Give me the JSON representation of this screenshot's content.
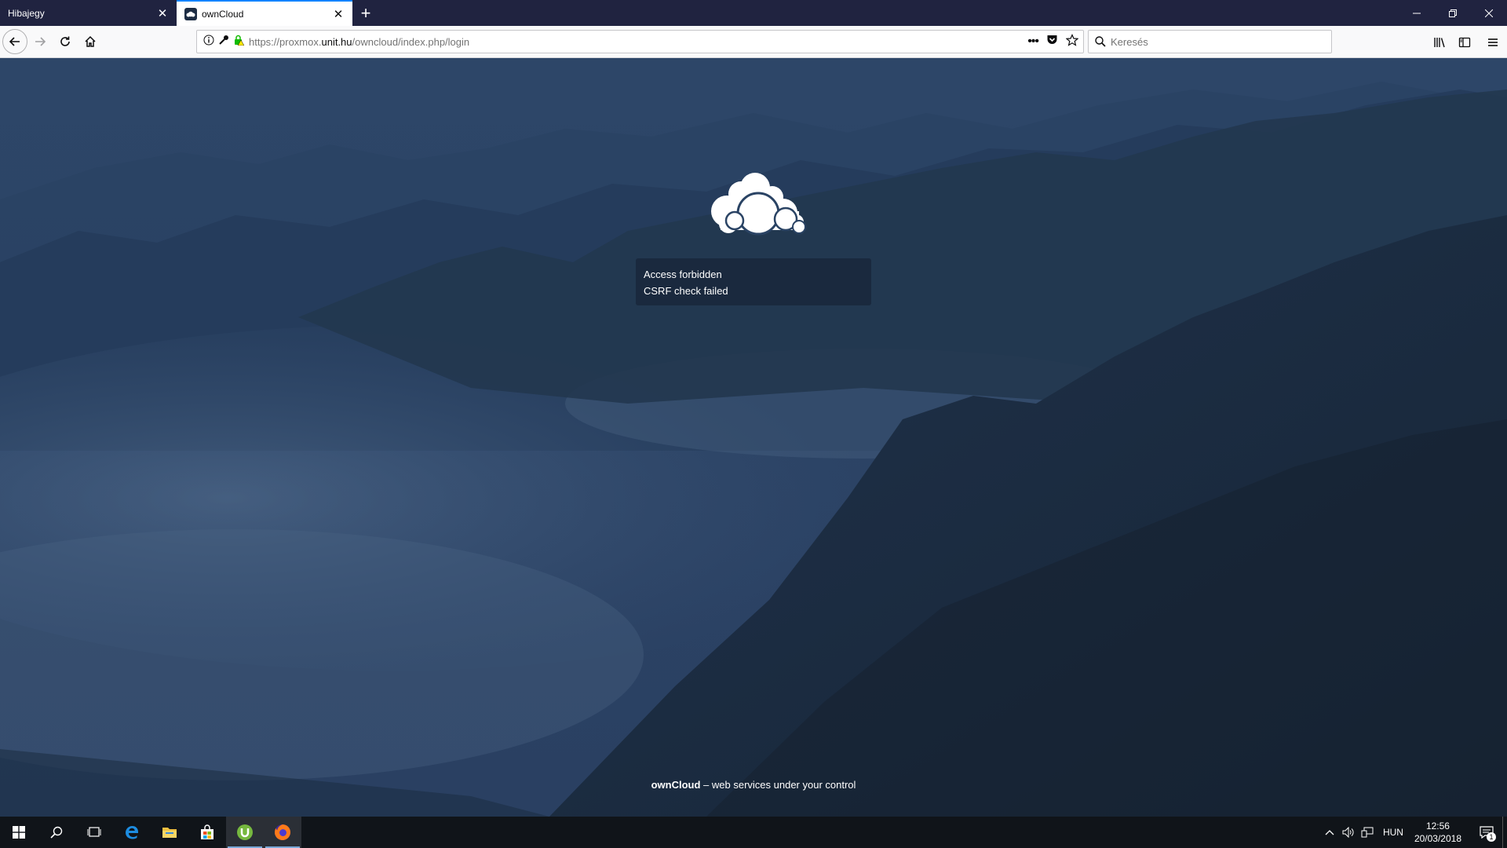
{
  "browser": {
    "tabs": [
      {
        "title": "Hibajegy",
        "active": false
      },
      {
        "title": "ownCloud",
        "active": true
      }
    ],
    "url": {
      "prefix": "https://proxmox.",
      "host": "unit.hu",
      "path": "/owncloud/index.php/login"
    },
    "search_placeholder": "Keresés"
  },
  "page": {
    "error_title": "Access forbidden",
    "error_detail": "CSRF check failed",
    "footer_brand": "ownCloud",
    "footer_tagline": " – web services under your control"
  },
  "taskbar": {
    "language": "HUN",
    "time": "12:56",
    "date": "20/03/2018",
    "notification_count": "1"
  },
  "colors": {
    "tabstrip": "#202340",
    "accent": "#0a84ff",
    "background": "#2a4364"
  }
}
